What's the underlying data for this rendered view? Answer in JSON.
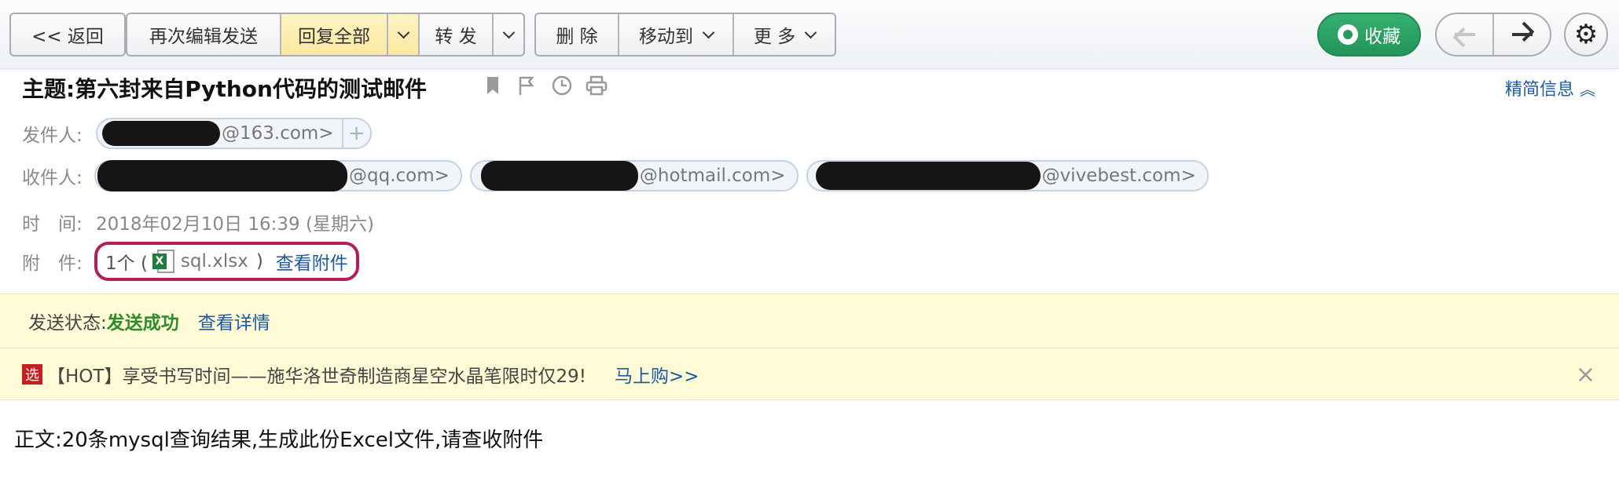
{
  "toolbar": {
    "back": "<< 返回",
    "reedit": "再次编辑发送",
    "reply_all": "回复全部",
    "forward": "转 发",
    "delete": "删 除",
    "move_to": "移动到",
    "more": "更 多",
    "favorite": "收藏"
  },
  "mail": {
    "subject": "主题:第六封来自Python代码的测试邮件",
    "brief_label": "精简信息",
    "sender_label": "发件人:",
    "sender_domain": "@163.com>",
    "recipient_label": "收件人:",
    "recipients": [
      "@qq.com>",
      "@hotmail.com>",
      "@vivebest.com>"
    ],
    "time_label": "时　间:",
    "time_value": "2018年02月10日 16:39 (星期六)",
    "attach_label": "附　件:",
    "attach_count_open": "1个 (",
    "attach_file": "sql.xlsx",
    "attach_close": ")",
    "attach_view": "查看附件"
  },
  "status": {
    "label": "发送状态:",
    "value": "发送成功",
    "detail": "查看详情"
  },
  "ad": {
    "icon_text": "选",
    "text": "【HOT】享受书写时间——施华洛世奇制造商星空水晶笔限时仅29!",
    "link": "马上购>>",
    "close": "×"
  },
  "body": {
    "text": "正文:20条mysql查询结果,生成此份Excel文件,请查收附件"
  },
  "colors": {
    "accent_link": "#1c5aa5",
    "favorite_green": "#26995d",
    "highlight_circle": "#b51d5a",
    "status_ok": "#2e8b2a"
  }
}
